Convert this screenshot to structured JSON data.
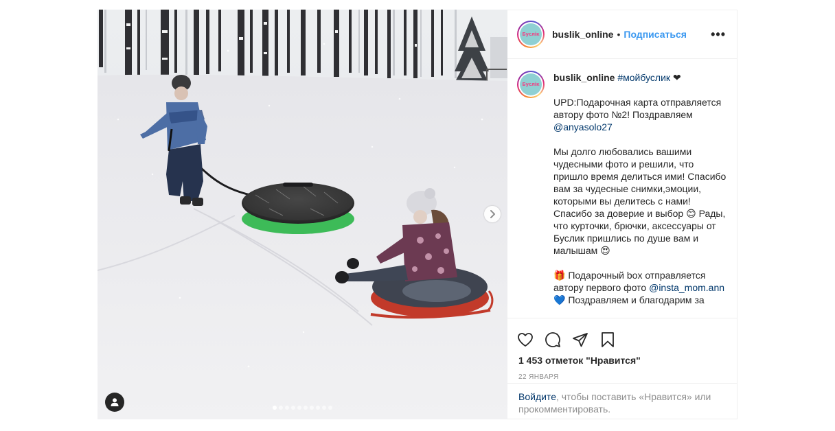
{
  "post": {
    "media": {
      "image_description_icon": "tagged-user-icon",
      "carousel_count": 10,
      "carousel_active_index": 0,
      "next_icon": "chevron-right-icon"
    },
    "header": {
      "username": "buslik_online",
      "separator": "•",
      "follow_label": "Подписаться",
      "more_label": "•••",
      "avatar_text": "Буслік"
    },
    "caption": {
      "username": "buslik_online",
      "hashtag": "#мойбуслик",
      "heart": "❤",
      "line1": "UPD:Подарочная карта отправляется автору фото №2! Поздравляем",
      "mention1": "@anyasolo27",
      "para2": "Мы долго любовались вашими чудесными фото и решили, что пришло время делиться ими! Спасибо вам за чудесные снимки,эмоции, которыми вы делитесь с нами! Спасибо за доверие и выбор 😊 Рады, что курточки, брючки, аксессуары от Буслик пришлись по душе вам и малышам 😍",
      "para3_text": "🎁 Подарочный box отправляется автору первого фото",
      "mention2": "@insta_mom.ann",
      "para3_tail": "💙 Поздравляем и благодарим за"
    },
    "actions": {
      "like_icon": "heart-icon",
      "comment_icon": "comment-icon",
      "share_icon": "share-icon",
      "save_icon": "bookmark-icon"
    },
    "likes": {
      "count": "1 453",
      "label": "отметок \"Нравится\""
    },
    "date": "22 января",
    "login": {
      "link": "Войдите",
      "text": ", чтобы поставить «Нравится» или прокомментировать."
    }
  },
  "colors": {
    "accent": "#3897f0",
    "link": "#00376b",
    "muted": "#8e8e8e",
    "text": "#262626",
    "border": "#efefef"
  }
}
